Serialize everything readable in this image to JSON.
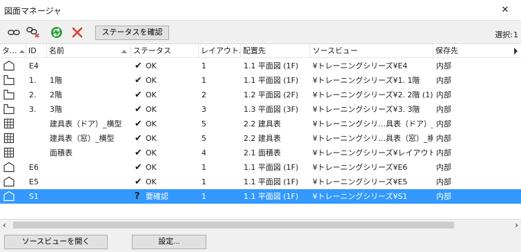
{
  "window": {
    "title": "図面マネージャ",
    "close_glyph": "✕"
  },
  "toolbar": {
    "icons": [
      "link-icon",
      "unlink-icon",
      "refresh-icon",
      "delete-icon"
    ],
    "status_check_label": "ステータスを確認",
    "selection_label": "選択:",
    "selection_count": "1"
  },
  "columns": {
    "type": "タ...",
    "id": "ID",
    "name": "名前",
    "status": "ステータス",
    "layout": "レイアウト...",
    "placement": "配置先",
    "source_view": "ソースビュー",
    "storage": "保存先"
  },
  "rows": [
    {
      "type_icon": "house-icon",
      "id": "E4",
      "name": "",
      "status_mark": "✔",
      "status": "OK",
      "layout": "1",
      "placement": "1.1 平面図 (1F)",
      "source_view": "¥トレーニングシリーズ¥E4",
      "storage": "内部",
      "selected": false
    },
    {
      "type_icon": "floor-plan-icon",
      "id": "1.",
      "name": "1階",
      "status_mark": "✔",
      "status": "OK",
      "layout": "1",
      "placement": "1.1 平面図 (1F)",
      "source_view": "¥トレーニングシリーズ¥1. 1階",
      "storage": "内部",
      "selected": false
    },
    {
      "type_icon": "floor-plan-icon",
      "id": "2.",
      "name": "2階",
      "status_mark": "✔",
      "status": "OK",
      "layout": "2",
      "placement": "1.2 平面図 (2F)",
      "source_view": "¥トレーニングシリーズ¥2. 2階 (1)",
      "storage": "内部",
      "selected": false
    },
    {
      "type_icon": "floor-plan-icon",
      "id": "3.",
      "name": "3階",
      "status_mark": "✔",
      "status": "OK",
      "layout": "3",
      "placement": "1.3 平面図 (3F)",
      "source_view": "¥トレーニングシリーズ¥3. 3階",
      "storage": "内部",
      "selected": false
    },
    {
      "type_icon": "schedule-icon",
      "id": "",
      "name": "建具表（ドア）_横型",
      "status_mark": "✔",
      "status": "OK",
      "layout": "5",
      "placement": "2.2 建具表",
      "source_view": "¥トレーニングシリ…具表（ドア）_横型",
      "storage": "内部",
      "selected": false
    },
    {
      "type_icon": "schedule-icon",
      "id": "",
      "name": "建具表（窓）_横型",
      "status_mark": "✔",
      "status": "OK",
      "layout": "5",
      "placement": "2.2 建具表",
      "source_view": "¥トレーニングシリ…具表（窓）_横型",
      "storage": "内部",
      "selected": false
    },
    {
      "type_icon": "schedule-icon",
      "id": "",
      "name": "面積表",
      "status_mark": "✔",
      "status": "OK",
      "layout": "4",
      "placement": "2.1 面積表",
      "source_view": "¥トレーニングシリーズ¥レイアウト¥面積表",
      "storage": "内部",
      "selected": false
    },
    {
      "type_icon": "house-icon",
      "id": "E6",
      "name": "",
      "status_mark": "✔",
      "status": "OK",
      "layout": "1",
      "placement": "1.1 平面図 (1F)",
      "source_view": "¥トレーニングシリーズ¥E6",
      "storage": "内部",
      "selected": false
    },
    {
      "type_icon": "house-icon",
      "id": "E5",
      "name": "",
      "status_mark": "✔",
      "status": "OK",
      "layout": "1",
      "placement": "1.1 平面図 (1F)",
      "source_view": "¥トレーニングシリーズ¥E5",
      "storage": "内部",
      "selected": false
    },
    {
      "type_icon": "house-icon",
      "id": "S1",
      "name": "",
      "status_mark": "?",
      "status": "要確認",
      "layout": "1",
      "placement": "1.1 平面図 (1F)",
      "source_view": "¥トレーニングシリーズ¥S1",
      "storage": "内部",
      "selected": true
    }
  ],
  "buttons": {
    "open_source_view": "ソースビューを開く",
    "settings": "設定..."
  },
  "colors": {
    "selection": "#3399ff",
    "refresh": "#2e9d3a",
    "delete": "#e03c2d"
  }
}
